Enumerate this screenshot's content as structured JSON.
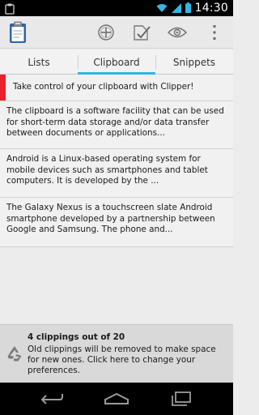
{
  "status_bar": {
    "time": "14:30"
  },
  "action_bar": {
    "app_icon": "clipboard-icon",
    "actions": [
      "add-icon",
      "select-icon",
      "view-icon",
      "overflow-icon"
    ]
  },
  "tabs": [
    {
      "label": "Lists"
    },
    {
      "label": "Clipboard",
      "selected": true
    },
    {
      "label": "Snippets"
    }
  ],
  "clippings": [
    {
      "text": "Take control of your clipboard with Clipper!",
      "pinned": true
    },
    {
      "text": "The clipboard is a software facility that can be used for short-term data storage and/or data transfer between documents or applications..."
    },
    {
      "text": "Android is a Linux-based operating system for mobile devices such as smartphones and tablet computers. It is developed by the ..."
    },
    {
      "text": "The Galaxy Nexus is a touchscreen slate Android smartphone developed by a partnership between Google and Samsung. The phone and..."
    }
  ],
  "footer": {
    "count": "4 clippings out of 20",
    "message": "Old clippings will be removed to make space for new ones. Click here to change your preferences."
  },
  "colors": {
    "accent": "#33b5e5",
    "pin": "#e8222b"
  }
}
